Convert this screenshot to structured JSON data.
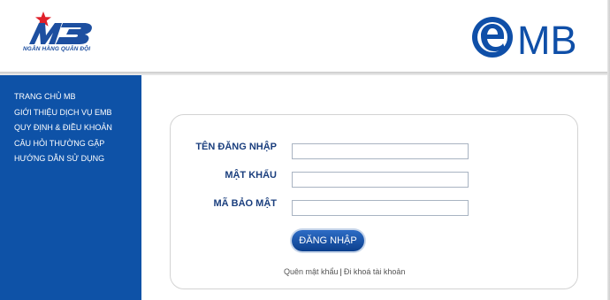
{
  "brand": {
    "mb_logo_text": "MB",
    "mb_tagline": "NGÂN HÀNG QUÂN ĐỘI",
    "emb_logo_text": "eMB"
  },
  "sidebar": {
    "items": [
      {
        "label": "TRANG CHỦ MB"
      },
      {
        "label": "GIỚI THIỆU DỊCH VỤ EMB"
      },
      {
        "label": "QUY ĐỊNH & ĐIỀU KHOẢN"
      },
      {
        "label": "CÂU HỎI THƯỜNG GẶP"
      },
      {
        "label": "HƯỚNG DẪN SỬ DỤNG"
      }
    ]
  },
  "login": {
    "username_label": "TÊN ĐĂNG NHẬP",
    "username_value": "",
    "password_label": "MẬT KHẨU",
    "password_value": "",
    "captcha_label": "MÃ BẢO MẬT",
    "captcha_value": "",
    "submit_label": "ĐĂNG NHẬP",
    "forgot_password_link": "Quên mật khẩu",
    "link_separator": "|",
    "register_link": "Đi khoá tài khoản"
  },
  "colors": {
    "sidebar_bg": "#0e52a7",
    "brand_blue": "#1d4fa0",
    "label_blue": "#1b3f7e",
    "star_red": "#e0202a"
  },
  "icons": {
    "mb_logo": "mb-bank-logo",
    "emb_logo": "emb-logo",
    "star": "red-star-icon"
  }
}
